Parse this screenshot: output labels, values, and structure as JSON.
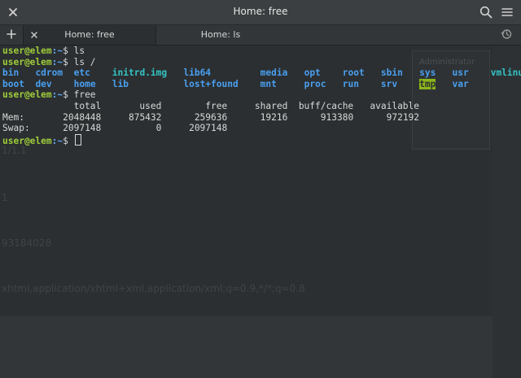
{
  "window": {
    "title": "Home: free"
  },
  "tabs": [
    {
      "label": "Home: free",
      "active": true
    },
    {
      "label": "Home: ls",
      "active": false
    }
  ],
  "terminal": {
    "prompt_user": "user@elem",
    "prompt_path": ":~",
    "prompt_symbol": "$ ",
    "cmd1": "ls",
    "cmd2": "ls /",
    "cmd3": "free",
    "ls_row1": [
      {
        "name": "bin",
        "type": "dir"
      },
      {
        "name": "cdrom",
        "type": "dir"
      },
      {
        "name": "etc",
        "type": "dir"
      },
      {
        "name": "initrd.img",
        "type": "link"
      },
      {
        "name": "lib64",
        "type": "dir"
      },
      {
        "name": "media",
        "type": "dir"
      },
      {
        "name": "opt",
        "type": "dir"
      },
      {
        "name": "root",
        "type": "dir"
      },
      {
        "name": "sbin",
        "type": "dir"
      },
      {
        "name": "sys",
        "type": "dir"
      },
      {
        "name": "usr",
        "type": "dir"
      },
      {
        "name": "vmlinuz",
        "type": "link"
      }
    ],
    "ls_row2": [
      {
        "name": "boot",
        "type": "dir"
      },
      {
        "name": "dev",
        "type": "dir"
      },
      {
        "name": "home",
        "type": "dir"
      },
      {
        "name": "lib",
        "type": "dir"
      },
      {
        "name": "lost+found",
        "type": "dir"
      },
      {
        "name": "mnt",
        "type": "dir"
      },
      {
        "name": "proc",
        "type": "dir"
      },
      {
        "name": "run",
        "type": "dir"
      },
      {
        "name": "srv",
        "type": "dir"
      },
      {
        "name": "tmp",
        "type": "sticky"
      },
      {
        "name": "var",
        "type": "dir"
      }
    ],
    "free_headers": [
      "total",
      "used",
      "free",
      "shared",
      "buff/cache",
      "available"
    ],
    "free_rows": [
      {
        "label": "Mem:",
        "values": [
          "2048448",
          "875432",
          "259636",
          "19216",
          "913380",
          "972192"
        ]
      },
      {
        "label": "Swap:",
        "values": [
          "2097148",
          "0",
          "2097148",
          "",
          "",
          ""
        ]
      }
    ]
  },
  "background_ghost": {
    "line1": "1/1.1",
    "line2": "1",
    "line3": "93184028",
    "line4": "xhtml,application/xhtml+xml,application/xml;q=0.9,*/*;q=0.8",
    "panel_text": "Administrator"
  },
  "colors": {
    "prompt_user": "#9fcd3a",
    "prompt_path": "#5aa6f0",
    "directory": "#4a9ff0",
    "symlink": "#34c4c4",
    "sticky_bg": "#8cb51a"
  },
  "icons": {
    "close": "close-icon",
    "search": "search-icon",
    "menu": "menu-icon",
    "new_tab": "plus-icon",
    "tab_close": "close-icon",
    "history": "history-icon"
  }
}
